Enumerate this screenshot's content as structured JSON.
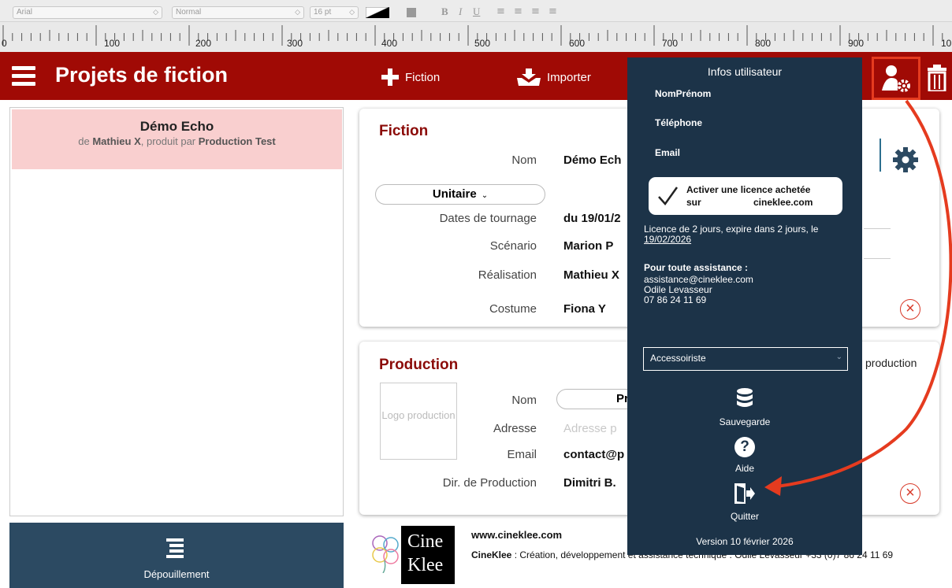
{
  "toolbar": {
    "font": "Arial",
    "style": "Normal",
    "size": "16 pt",
    "bold": "B",
    "italic": "I",
    "underline": "U"
  },
  "ruler": {
    "labels": [
      "0",
      "100",
      "200",
      "300",
      "400",
      "500",
      "600",
      "700",
      "800",
      "900",
      "10"
    ]
  },
  "header": {
    "title": "Projets de fiction",
    "add_fiction": "Fiction",
    "import": "Importer"
  },
  "sidebar": {
    "project": {
      "title": "Démo Echo",
      "by_prefix": "de ",
      "director": "Mathieu X",
      "produced_prefix": ", produit par ",
      "production": "Production Test"
    },
    "depouillement": "Dépouillement"
  },
  "fiction": {
    "title": "Fiction",
    "type": "Unitaire",
    "fields": [
      {
        "label": "Nom",
        "value": "Démo Ech"
      },
      {
        "label": "Dates de tournage",
        "value": "du 19/01/2"
      },
      {
        "label": "Scénario",
        "value": "Marion P"
      },
      {
        "label": "Réalisation",
        "value": "Mathieu X"
      },
      {
        "label": "Costume",
        "value": "Fiona Y"
      }
    ]
  },
  "production": {
    "title": "Production",
    "logo": "Logo production",
    "side_label": "production",
    "fields": [
      {
        "label": "Nom",
        "value": "Pro"
      },
      {
        "label": "Adresse",
        "value": "Adresse p"
      },
      {
        "label": "Email",
        "value": "contact@p"
      },
      {
        "label": "Dir. de Production",
        "value": "Dimitri B."
      }
    ]
  },
  "footer": {
    "logo_text": [
      "Cine",
      "Klee"
    ],
    "website": "www.cineklee.com",
    "company": "CineKlee",
    "description": " : Création, développement et assistance technique : Odile Levasseur +33 (0)7 86 24 11 69"
  },
  "user_popup": {
    "title": "Infos utilisateur",
    "name": "NomPrénom",
    "phone": "Téléphone",
    "email": "Email",
    "license_button": [
      "Activer une licence achetée",
      "sur",
      "cineklee.com"
    ],
    "license_info": "Licence de 2 jours, expire dans 2 jours, le ",
    "license_date": "19/02/2026",
    "support_title": "Pour toute assistance :",
    "support_email": "assistance@cineklee.com",
    "support_name": "Odile Levasseur",
    "support_phone": "07 86 24 11 69",
    "role": "Accessoiriste",
    "backup": "Sauvegarde",
    "help": "Aide",
    "quit": "Quitter",
    "version": "Version 10 février 2026"
  },
  "colors": {
    "header": "#a00a05",
    "accent": "#8b0b08",
    "popup": "#1c3348",
    "highlight": "#e53b1f"
  }
}
